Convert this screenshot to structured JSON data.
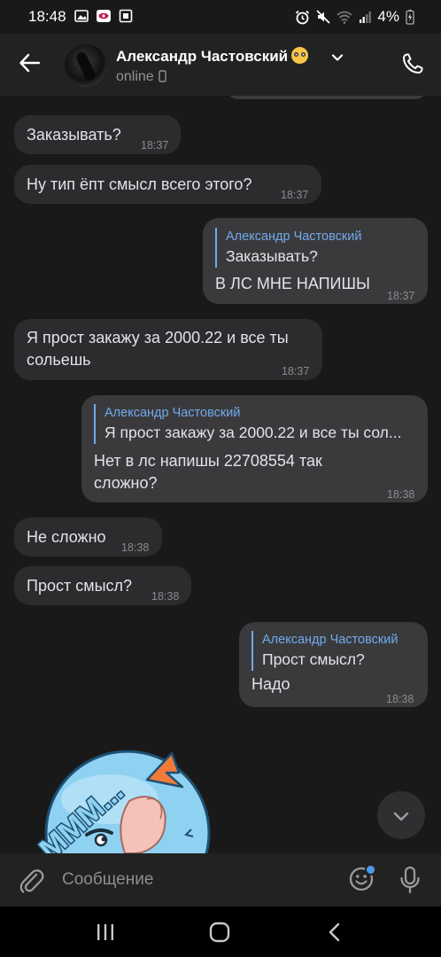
{
  "status_bar": {
    "time": "18:48",
    "battery": "4%"
  },
  "header": {
    "contact_name": "Александр Частовский",
    "status": "online"
  },
  "composer": {
    "placeholder": "Сообщение"
  },
  "messages": [
    {
      "dir": "in",
      "text": "Заказывать?",
      "time": "18:37"
    },
    {
      "dir": "in",
      "text": "Ну тип ёпт смысл всего этого?",
      "time": "18:37"
    },
    {
      "dir": "out",
      "reply_name": "Александр Частовский",
      "reply_text": "Заказывать?",
      "text": "В ЛС МНЕ НАПИШЫ",
      "time": "18:37"
    },
    {
      "dir": "in",
      "text": "Я прост закажу за 2000.22 и все ты сольешь",
      "time": "18:37"
    },
    {
      "dir": "out",
      "reply_name": "Александр Частовский",
      "reply_text": "Я прост закажу за 2000.22 и все ты сол...",
      "text": "Нет в лс напишы 22708554 так сложно?",
      "time": "18:38"
    },
    {
      "dir": "in",
      "text": "Не сложно",
      "time": "18:38"
    },
    {
      "dir": "in",
      "text": "Прост смысл?",
      "time": "18:38"
    },
    {
      "dir": "out",
      "reply_name": "Александр Частовский",
      "reply_text": "Прост смысл?",
      "text": "Надо",
      "time": "18:38"
    }
  ],
  "sticker": {
    "text": "МММ..."
  },
  "colors": {
    "background": "#191919",
    "bubble_in": "#2c2c2e",
    "bubble_out": "#3a3a3c",
    "accent": "#71aaeb"
  }
}
